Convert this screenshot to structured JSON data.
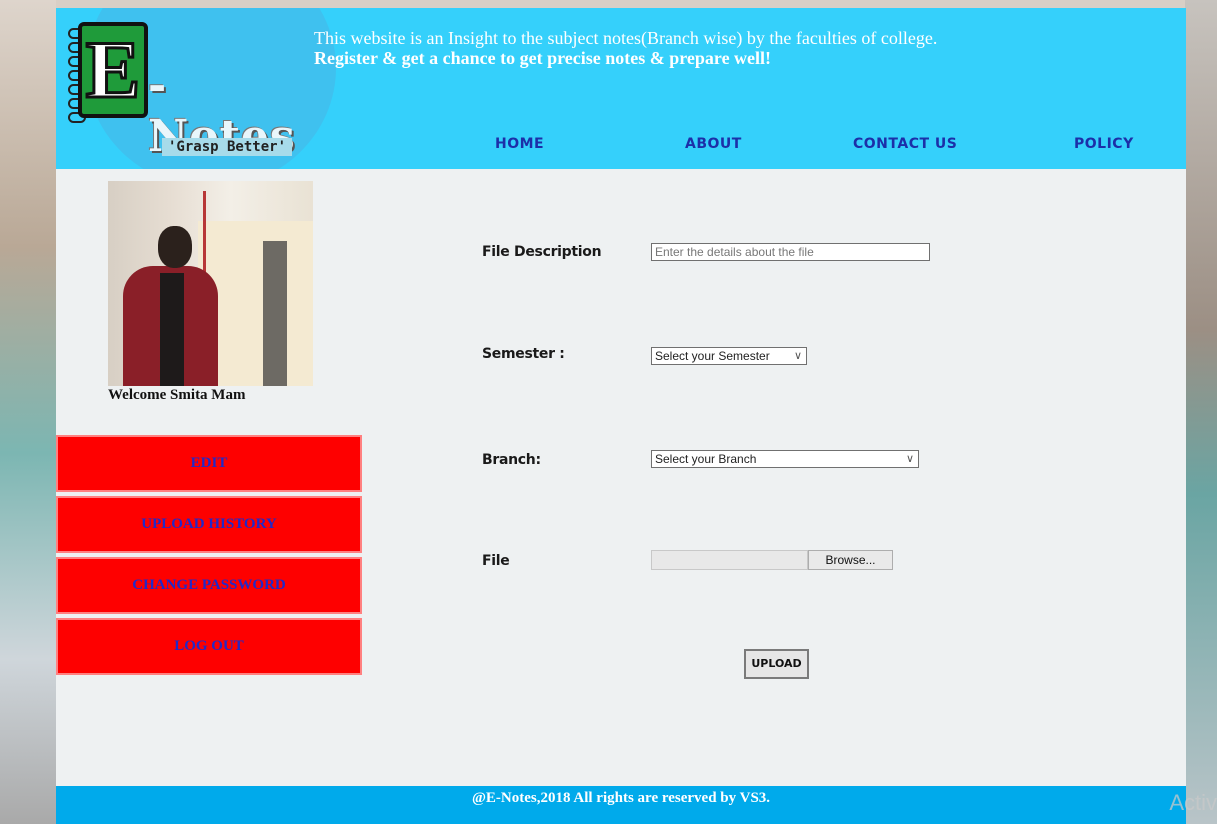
{
  "header": {
    "logo_letter": "E",
    "logo_word": "-Notes",
    "tagline": "'Grasp Better'",
    "line1": "This website is an Insight to the subject notes(Branch wise) by the faculties of college.",
    "line2": "Register & get a chance to get precise notes & prepare well!"
  },
  "nav": [
    "HOME",
    "ABOUT",
    "CONTACT US",
    "POLICY"
  ],
  "sidebar": {
    "welcome": "Welcome Smita Mam",
    "menu": [
      "EDIT",
      "UPLOAD HISTORY",
      "CHANGE PASSWORD",
      "LOG OUT"
    ]
  },
  "form": {
    "description_label": "File Description",
    "description_placeholder": "Enter the details about the file",
    "semester_label": "Semester :",
    "semester_value": "Select your Semester",
    "branch_label": "Branch:",
    "branch_value": "Select your Branch",
    "file_label": "File",
    "browse_label": "Browse...",
    "upload_label": "UPLOAD"
  },
  "footer": {
    "text": "@E-Notes,2018 All rights are reserved by VS3."
  },
  "watermark": "Activ",
  "colors": {
    "header": "#35d0fb",
    "menu": "#fe0000",
    "menu_text": "#2229c7",
    "footer": "#00aaeb"
  }
}
